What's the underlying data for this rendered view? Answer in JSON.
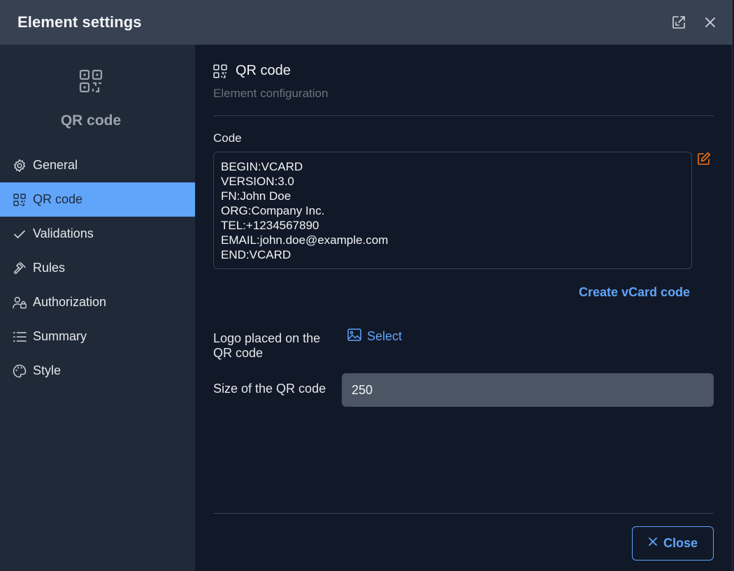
{
  "dialog": {
    "title": "Element settings",
    "icons": {
      "expand": "expand-icon",
      "close": "close-icon"
    }
  },
  "sidebar": {
    "header_title": "QR code",
    "header_icon": "qr-code-icon",
    "items": [
      {
        "label": "General",
        "icon": "gear-icon",
        "active": false
      },
      {
        "label": "QR code",
        "icon": "qr-code-icon",
        "active": true
      },
      {
        "label": "Validations",
        "icon": "check-icon",
        "active": false
      },
      {
        "label": "Rules",
        "icon": "gavel-icon",
        "active": false
      },
      {
        "label": "Authorization",
        "icon": "user-lock-icon",
        "active": false
      },
      {
        "label": "Summary",
        "icon": "list-icon",
        "active": false
      },
      {
        "label": "Style",
        "icon": "palette-icon",
        "active": false
      }
    ]
  },
  "main": {
    "section_title": "QR code",
    "section_subtitle": "Element configuration",
    "code_label": "Code",
    "code_lines": [
      "BEGIN:VCARD",
      "VERSION:3.0",
      "FN:John Doe",
      "ORG:Company Inc.",
      "TEL:+1234567890",
      "EMAIL:john.doe@example.com",
      "END:VCARD"
    ],
    "create_vcard_label": "Create vCard code",
    "logo_label": "Logo placed on the QR code",
    "select_label": "Select",
    "size_label": "Size of the QR code",
    "size_value": "250",
    "close_label": "Close"
  },
  "colors": {
    "accent": "#60a5fa",
    "edit_icon": "#f97316",
    "titlebar_bg": "#374151",
    "sidebar_bg": "#1f2937",
    "main_bg": "#111827"
  }
}
